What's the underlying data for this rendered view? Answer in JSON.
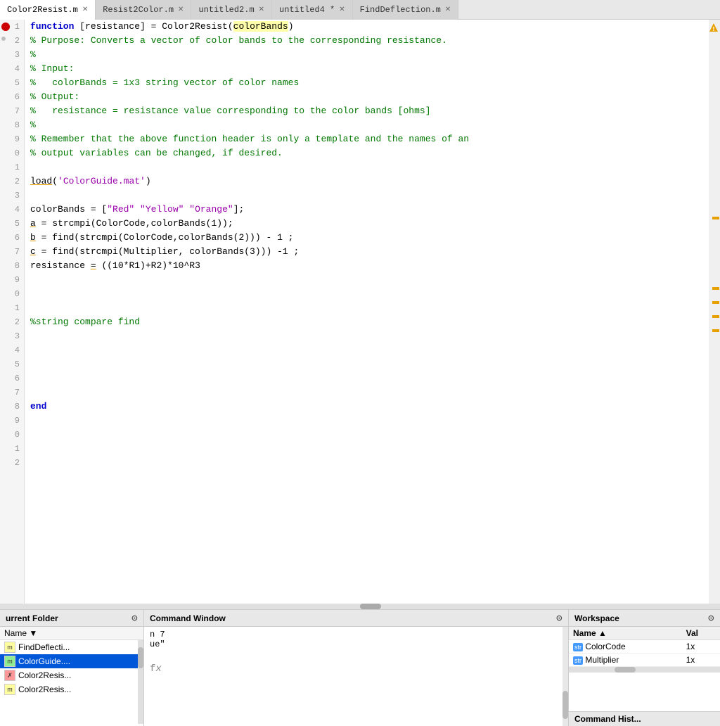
{
  "tabs": [
    {
      "label": "Color2Resist.m",
      "active": true,
      "closeable": true
    },
    {
      "label": "Resist2Color.m",
      "active": false,
      "closeable": true
    },
    {
      "label": "untitled2.m",
      "active": false,
      "closeable": true
    },
    {
      "label": "untitled4 *",
      "active": false,
      "closeable": true
    },
    {
      "label": "FindDeflection.m",
      "active": false,
      "closeable": true
    }
  ],
  "line_numbers": [
    "1",
    "2",
    "3",
    "4",
    "5",
    "6",
    "7",
    "8",
    "9",
    "0",
    "1",
    "2",
    "3",
    "4",
    "5",
    "6",
    "7",
    "8",
    "9",
    "0",
    "1",
    "2",
    "3",
    "4",
    "5",
    "6",
    "7",
    "8",
    "9",
    "0",
    "1",
    "2"
  ],
  "code_lines": [
    {
      "type": "code",
      "content": "function [resistance] = Color2Resist(colorBands)"
    },
    {
      "type": "code",
      "content": "% Purpose: Converts a vector of color bands to the corresponding resistance."
    },
    {
      "type": "code",
      "content": "%"
    },
    {
      "type": "code",
      "content": "% Input:"
    },
    {
      "type": "code",
      "content": "%   colorBands = 1x3 string vector of color names"
    },
    {
      "type": "code",
      "content": "% Output:"
    },
    {
      "type": "code",
      "content": "%   resistance = resistance value corresponding to the color bands [ohms]"
    },
    {
      "type": "code",
      "content": "%"
    },
    {
      "type": "code",
      "content": "% Remember that the above function header is only a template and the names of an"
    },
    {
      "type": "code",
      "content": "% output variables can be changed, if desired."
    },
    {
      "type": "blank"
    },
    {
      "type": "code",
      "content": "load('ColorGuide.mat')"
    },
    {
      "type": "blank"
    },
    {
      "type": "code",
      "content": "colorBands = [\"Red\" \"Yellow\" \"Orange\"];"
    },
    {
      "type": "code",
      "content": "a = strcmpi(ColorCode,colorBands(1));"
    },
    {
      "type": "code",
      "content": "b = find(strcmpi(ColorCode,colorBands(2))) - 1 ;"
    },
    {
      "type": "code",
      "content": "c = find(strcmpi(Multiplier, colorBands(3))) -1 ;"
    },
    {
      "type": "code",
      "content": "resistance = ((10*R1)+R2)*10^R3"
    },
    {
      "type": "blank"
    },
    {
      "type": "blank"
    },
    {
      "type": "blank"
    },
    {
      "type": "code",
      "content": "%string compare find"
    },
    {
      "type": "blank"
    },
    {
      "type": "blank"
    },
    {
      "type": "blank"
    },
    {
      "type": "blank"
    },
    {
      "type": "blank"
    },
    {
      "type": "code",
      "content": "end"
    }
  ],
  "panels": {
    "current_folder": {
      "title": "urrent Folder",
      "col_header": "Name",
      "items": [
        {
          "name": "FindDeflecti...",
          "type": "m",
          "selected": false
        },
        {
          "name": "ColorGuide....",
          "type": "mat",
          "selected": true
        },
        {
          "name": "Color2Resis...",
          "type": "err",
          "selected": false
        },
        {
          "name": "Color2Resis...",
          "type": "m",
          "selected": false
        }
      ]
    },
    "command_window": {
      "title": "Command Window",
      "lines": [
        "n 7",
        "",
        "ue\"",
        "",
        "fx"
      ]
    },
    "workspace": {
      "title": "Workspace",
      "col_name": "Name",
      "col_val": "Val",
      "items": [
        {
          "name": "ColorCode",
          "type": "str",
          "value": "1x"
        },
        {
          "name": "Multiplier",
          "type": "str",
          "value": "1x"
        }
      ],
      "bottom_label": "Command Hist..."
    }
  }
}
